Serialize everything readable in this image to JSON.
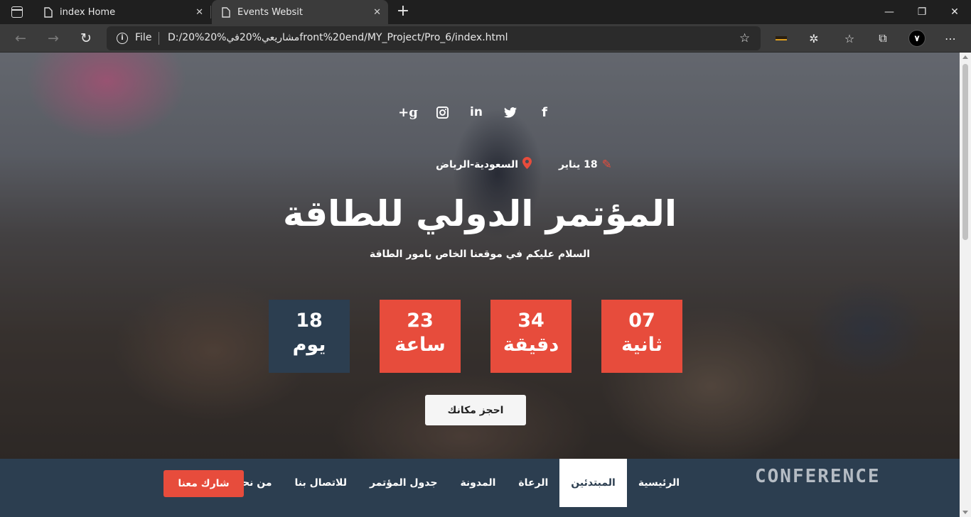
{
  "browser": {
    "tabs": [
      {
        "title": "index Home",
        "close": "✕"
      },
      {
        "title": "Events Websit",
        "close": "✕"
      }
    ],
    "new_tab": "+",
    "window_controls": {
      "minimize": "—",
      "restore": "❐",
      "close": "✕"
    },
    "toolbar": {
      "back": "←",
      "forward": "→",
      "refresh": "↻",
      "file_label": "File",
      "url": "D:/20%مشاريعي%20في%20front%20end/MY_Project/Pro_6/index.html",
      "profile_initial": "٧"
    }
  },
  "page": {
    "social_icons": [
      "facebook-icon",
      "twitter-icon",
      "linkedin-icon",
      "instagram-icon",
      "google-plus-icon"
    ],
    "social_glyphs": {
      "facebook": "f",
      "twitter": "🐦",
      "linkedin": "in",
      "instagram": "◘",
      "google_plus": "g+"
    },
    "event_date": "18 يناير",
    "event_location": "السعودية-الرياض",
    "title": "المؤتمر الدولي للطاقة",
    "subtitle": "السلام عليكم في موقعنا الخاص بامور الطاقة",
    "countdown": {
      "days": {
        "value": "18",
        "label": "يوم"
      },
      "hours": {
        "value": "23",
        "label": "ساعة"
      },
      "minutes": {
        "value": "34",
        "label": "دقيقة"
      },
      "seconds": {
        "value": "07",
        "label": "ثانية"
      }
    },
    "book_button": "احجز مكانك",
    "navbar": {
      "logo": "CONFERENCE",
      "links": [
        "الرئيسية",
        "المبتدئين",
        "الرعاة",
        "المدونة",
        "جدول المؤتمر",
        "للاتصال بنا",
        "من نحن"
      ],
      "active_index": 1,
      "join_button": "شارك معنا"
    },
    "colors": {
      "accent": "#e74c3c",
      "dark": "#2c3e50"
    }
  }
}
